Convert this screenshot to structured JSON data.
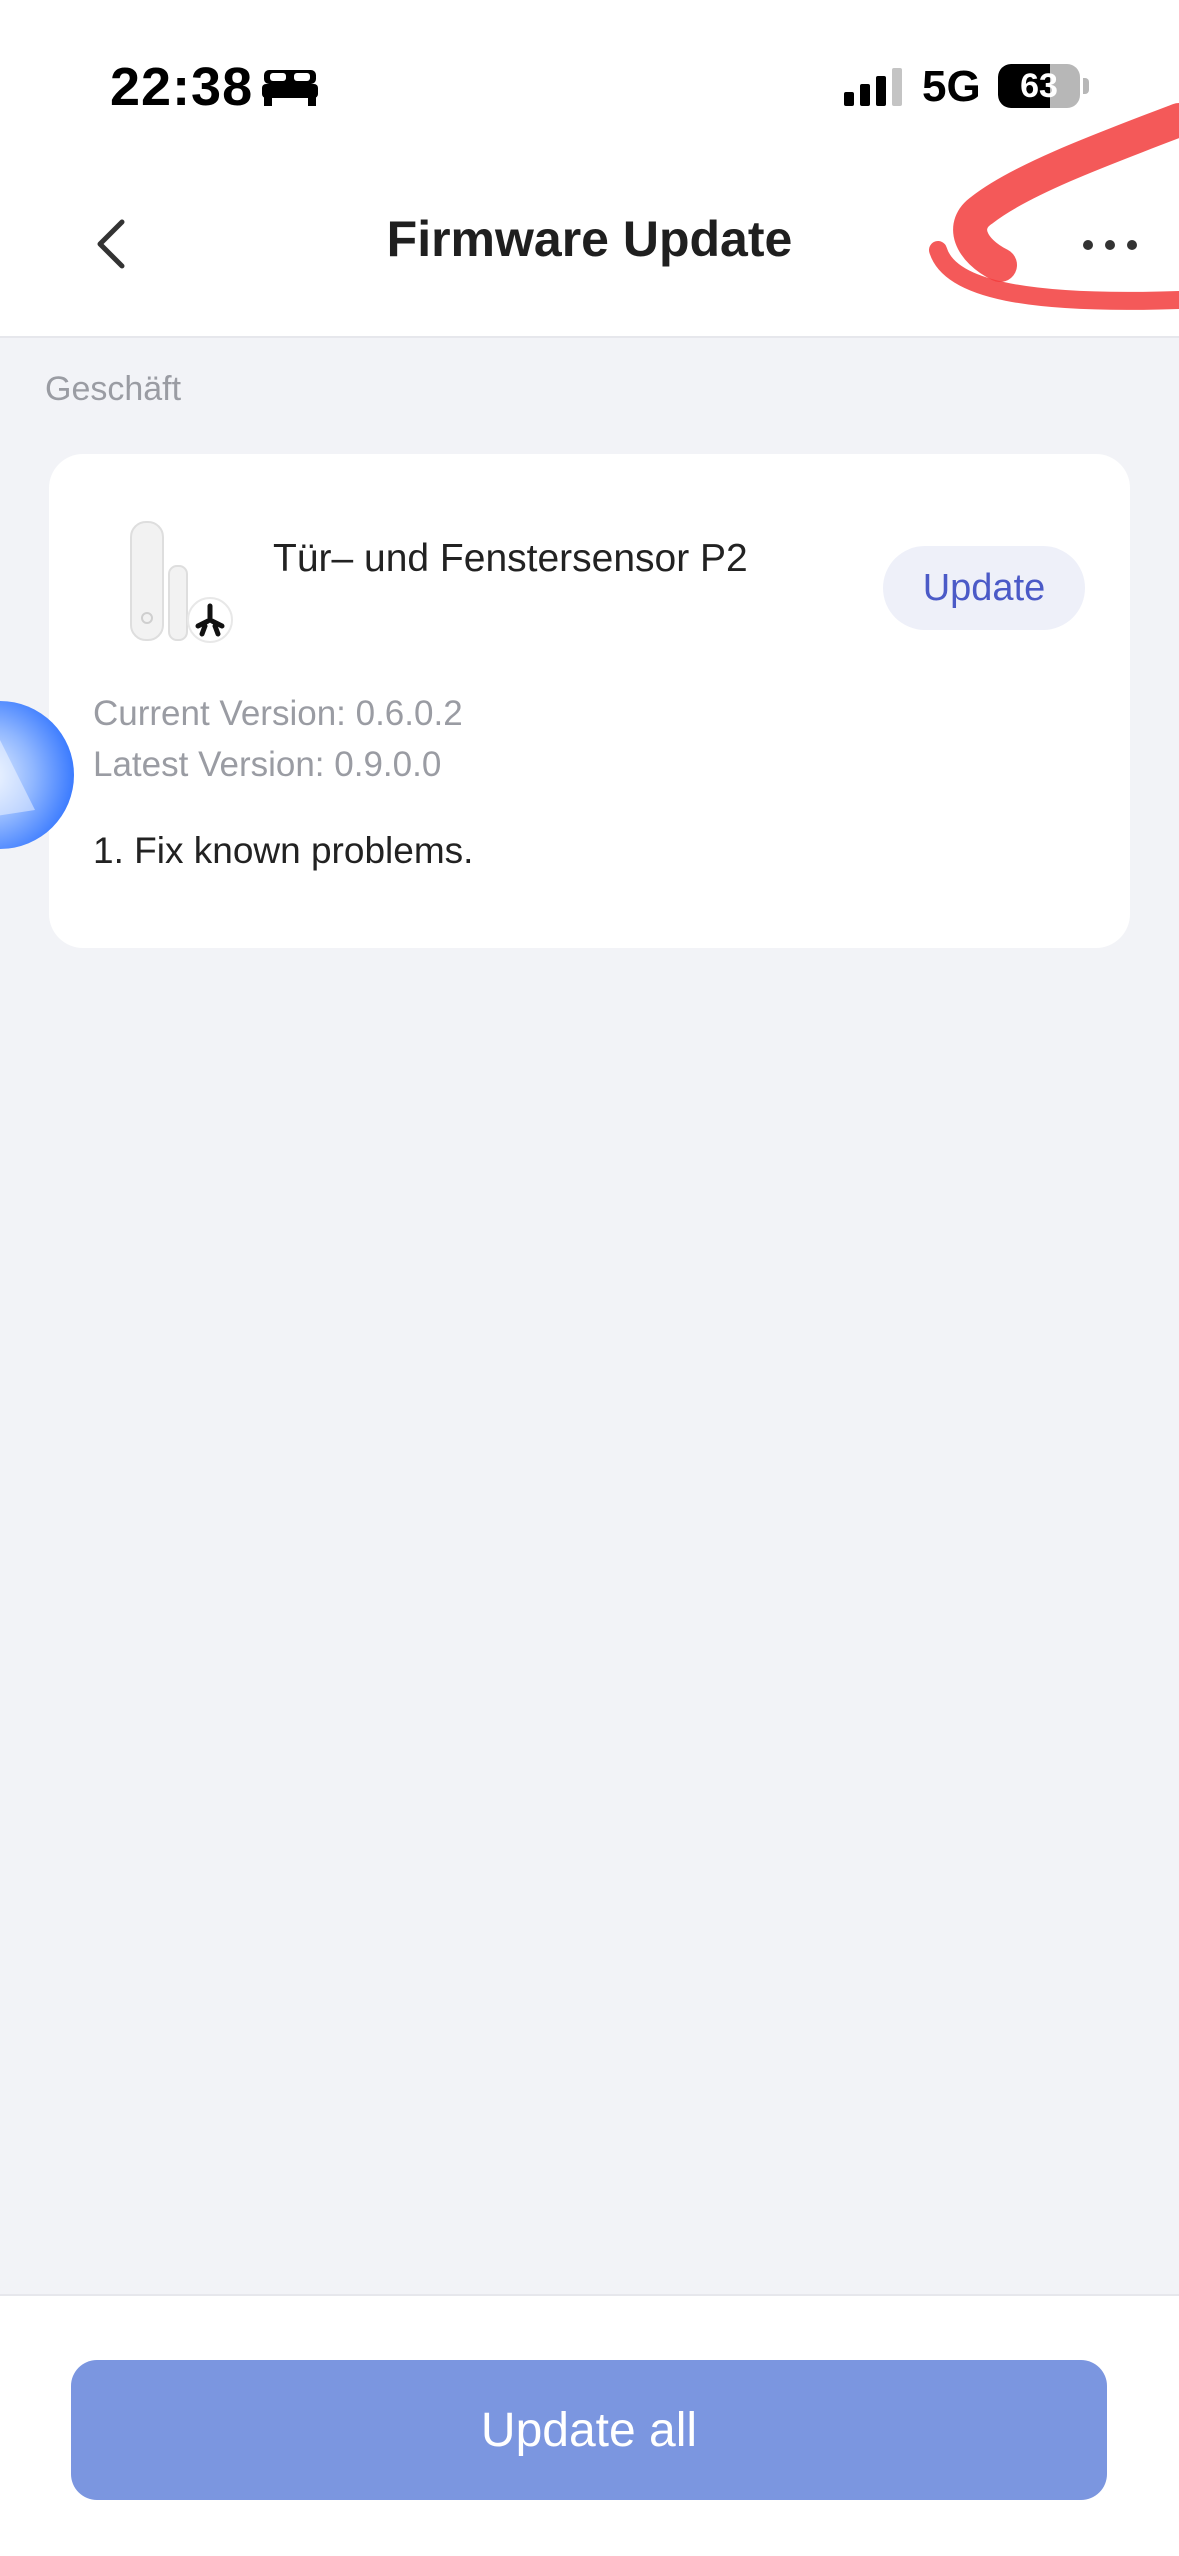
{
  "status_bar": {
    "time": "22:38",
    "focus_icon": "bed-icon",
    "signal_icon": "cellular-signal-icon",
    "network": "5G",
    "battery": "63",
    "battery_level": 0.63
  },
  "header": {
    "title": "Firmware Update",
    "back_icon": "chevron-left-icon",
    "more_icon": "more-horizontal-icon"
  },
  "section": {
    "label": "Geschäft"
  },
  "device": {
    "name": "Tür– und Fenstersensor P2",
    "image_icon": "door-window-sensor-icon",
    "badge_icon": "matter-icon",
    "update_label": "Update",
    "current_version": "Current Version: 0.6.0.2",
    "latest_version": "Latest Version: 0.9.0.0",
    "changelog": "1. Fix known problems."
  },
  "footer": {
    "update_all_label": "Update all"
  },
  "colors": {
    "accent": "#4b5ac7",
    "primary_button": "#7b96e0",
    "background": "#f2f3f7",
    "annotation": "#f23c3c"
  }
}
